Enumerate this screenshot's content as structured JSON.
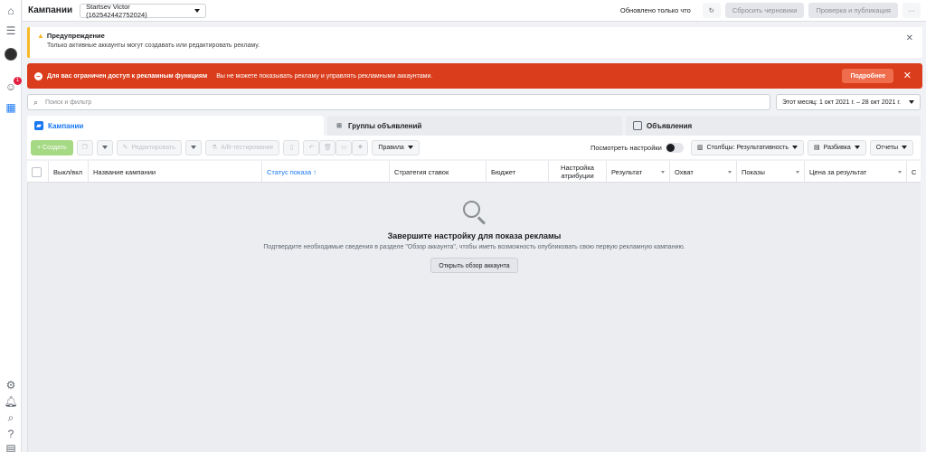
{
  "topbar": {
    "title": "Кампании",
    "account": "Startsev Victor (162542442752024)",
    "updated": "Обновлено только что",
    "reset_label": "Сбросить черновики",
    "publish_label": "Проверка и публикация",
    "more": "···"
  },
  "rail": {
    "notification_count": "1"
  },
  "warning": {
    "title": "Предупреждение",
    "body": "Только активные аккаунты могут создавать или редактировать рекламу."
  },
  "error": {
    "bold": "Для вас ограничен доступ к рекламным функциям",
    "text": "Вы не можете показывать рекламу и управлять рекламными аккаунтами.",
    "more_label": "Подробнее"
  },
  "search": {
    "placeholder": "Поиск и фильтр"
  },
  "date_range": "Этот месяц: 1 окт 2021 г. – 28 окт 2021 г.",
  "tabs": [
    {
      "label": "Кампании"
    },
    {
      "label": "Группы объявлений"
    },
    {
      "label": "Объявления"
    }
  ],
  "toolbar": {
    "create": "+ Создать",
    "edit": "Редактировать",
    "ab_test": "A/B-тестирование",
    "rules": "Правила",
    "view_settings": "Посмотреть настройки",
    "columns": "Столбцы: Результативность",
    "breakdown": "Разбивка",
    "reports": "Отчеты"
  },
  "columns": [
    "Выкл/вкл",
    "Название кампании",
    "Статус показа ↑",
    "Стратегия ставок",
    "Бюджет",
    "Настройка атрибуции",
    "Результат",
    "Охват",
    "Показы",
    "Цена за результат",
    "С"
  ],
  "empty": {
    "title": "Завершите настройку для показа рекламы",
    "text": "Подтвердите необходимые сведения в разделе \"Обзор аккаунта\", чтобы иметь возможность опубликовать свою первую рекламную кампанию.",
    "button": "Открыть обзор аккаунта"
  },
  "colors": {
    "accent": "#1877f2",
    "error": "#da3d1b",
    "warning": "#f7b928",
    "create": "#a6d984"
  }
}
